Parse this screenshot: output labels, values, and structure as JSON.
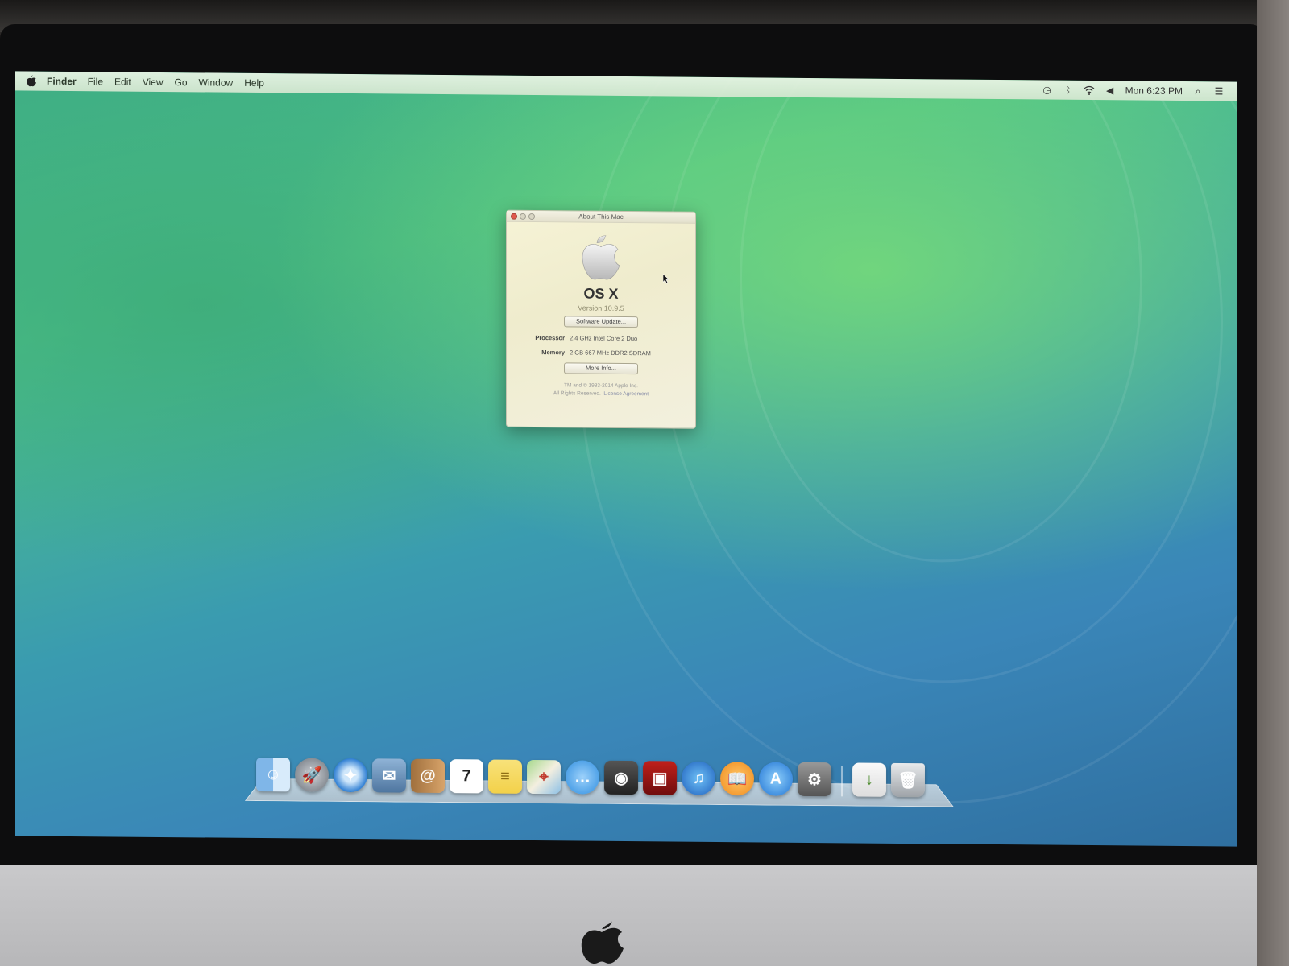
{
  "menubar": {
    "app_name": "Finder",
    "items": [
      "File",
      "Edit",
      "View",
      "Go",
      "Window",
      "Help"
    ],
    "status_icons": [
      "time-machine-icon",
      "bluetooth-icon",
      "wifi-icon",
      "volume-icon"
    ],
    "clock": "Mon 6:23 PM"
  },
  "about_window": {
    "title": "About This Mac",
    "os_name": "OS X",
    "version": "Version 10.9.5",
    "software_update_button": "Software Update...",
    "specs": [
      {
        "label": "Processor",
        "value": "2.4 GHz Intel Core 2 Duo"
      },
      {
        "label": "Memory",
        "value": "2 GB 667 MHz DDR2 SDRAM"
      }
    ],
    "more_info_button": "More Info...",
    "legal_line1": "TM and © 1983-2014 Apple Inc.",
    "legal_line2": "All Rights Reserved.",
    "license_link": "License Agreement"
  },
  "dock": {
    "apps": [
      {
        "name": "finder-icon",
        "glyph": "☺"
      },
      {
        "name": "launchpad-icon",
        "glyph": "🚀"
      },
      {
        "name": "safari-icon",
        "glyph": "✦"
      },
      {
        "name": "mail-icon",
        "glyph": "✉"
      },
      {
        "name": "contacts-icon",
        "glyph": "@"
      },
      {
        "name": "calendar-icon",
        "glyph": "7"
      },
      {
        "name": "notes-icon",
        "glyph": "≡"
      },
      {
        "name": "maps-icon",
        "glyph": "⌖"
      },
      {
        "name": "messages-icon",
        "glyph": "…"
      },
      {
        "name": "facetime-icon",
        "glyph": "◉"
      },
      {
        "name": "photo-booth-icon",
        "glyph": "▣"
      },
      {
        "name": "itunes-icon",
        "glyph": "♫"
      },
      {
        "name": "ibooks-icon",
        "glyph": "📖"
      },
      {
        "name": "app-store-icon",
        "glyph": "A"
      },
      {
        "name": "system-preferences-icon",
        "glyph": "⚙"
      }
    ],
    "stack": {
      "name": "downloads-stack-icon",
      "glyph": "↓"
    },
    "trash": {
      "name": "trash-icon",
      "glyph": "🗑"
    }
  }
}
